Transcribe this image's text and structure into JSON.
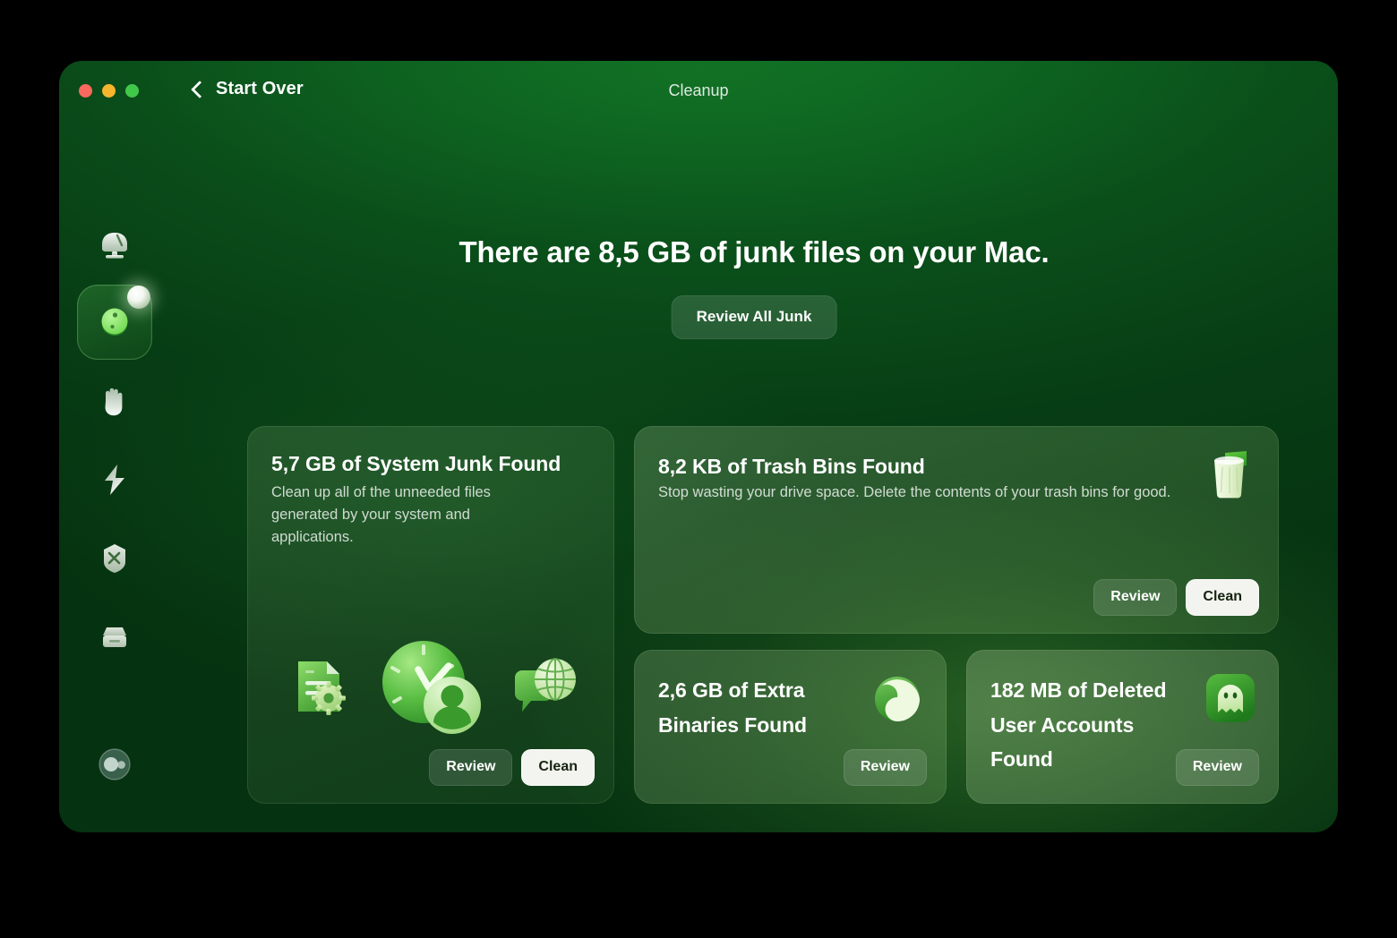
{
  "window": {
    "title": "Cleanup",
    "back_label": "Start Over",
    "traffic_lights": [
      "close",
      "minimize",
      "zoom"
    ]
  },
  "sidebar": {
    "items": [
      {
        "id": "smart-scan",
        "icon": "smart-scan-icon",
        "active": false
      },
      {
        "id": "cleanup",
        "icon": "cleanup-icon",
        "active": true
      },
      {
        "id": "protection",
        "icon": "hand-shield-icon",
        "active": false
      },
      {
        "id": "performance",
        "icon": "lightning-icon",
        "active": false
      },
      {
        "id": "applications",
        "icon": "applications-icon",
        "active": false
      },
      {
        "id": "my-clutter",
        "icon": "drawer-icon",
        "active": false
      }
    ],
    "account": {
      "id": "account",
      "icon": "account-avatar-icon"
    }
  },
  "main": {
    "headline": "There are 8,5 GB of junk files on your Mac.",
    "review_all_label": "Review All Junk"
  },
  "cards": {
    "system_junk": {
      "title": "5,7 GB of System Junk Found",
      "description": "Clean up all of the unneeded files generated by your system and applications.",
      "review_label": "Review",
      "clean_label": "Clean",
      "illustration_icons": [
        "document-gear-icon",
        "clock-user-icon",
        "chat-globe-icon"
      ]
    },
    "trash_bins": {
      "title": "8,2 KB of Trash Bins Found",
      "description": "Stop wasting your drive space. Delete the contents of your trash bins for good.",
      "review_label": "Review",
      "clean_label": "Clean",
      "icon": "trash-bin-icon"
    },
    "extra_binaries": {
      "title": "2,6 GB of Extra Binaries Found",
      "review_label": "Review",
      "icon": "binaries-circle-icon"
    },
    "deleted_users": {
      "title": "182 MB of Deleted User Accounts Found",
      "review_label": "Review",
      "icon": "ghost-icon"
    }
  },
  "colors": {
    "accent_green": "#5ec94f",
    "window_bg_dark": "#053210",
    "window_bg_light": "#0e6b22",
    "primary_button_bg": "#f3f4ef",
    "traffic_red": "#f9695d",
    "traffic_yellow": "#f5b52c",
    "traffic_green": "#41c84b"
  }
}
